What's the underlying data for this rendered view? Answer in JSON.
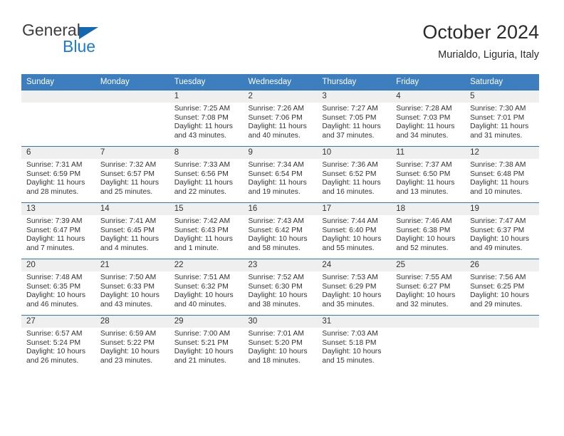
{
  "logo": {
    "word_top": "General",
    "word_bottom": "Blue",
    "triangle_color": "#1368b0",
    "blue_color": "#1b7ad1"
  },
  "header": {
    "title": "October 2024",
    "location": "Murialdo, Liguria, Italy"
  },
  "theme": {
    "header_blue": "#3c7ebe",
    "row_rule_blue": "#2f76bb",
    "daynum_band": "#efefef"
  },
  "weekday_headers": [
    "Sunday",
    "Monday",
    "Tuesday",
    "Wednesday",
    "Thursday",
    "Friday",
    "Saturday"
  ],
  "labels": {
    "sunrise": "Sunrise:",
    "sunset": "Sunset:",
    "daylight": "Daylight:"
  },
  "weeks": [
    [
      {
        "day": "",
        "sunrise": "",
        "sunset": "",
        "daylight_line1": "",
        "daylight_line2": ""
      },
      {
        "day": "",
        "sunrise": "",
        "sunset": "",
        "daylight_line1": "",
        "daylight_line2": ""
      },
      {
        "day": "1",
        "sunrise": "Sunrise: 7:25 AM",
        "sunset": "Sunset: 7:08 PM",
        "daylight_line1": "Daylight: 11 hours",
        "daylight_line2": "and 43 minutes."
      },
      {
        "day": "2",
        "sunrise": "Sunrise: 7:26 AM",
        "sunset": "Sunset: 7:06 PM",
        "daylight_line1": "Daylight: 11 hours",
        "daylight_line2": "and 40 minutes."
      },
      {
        "day": "3",
        "sunrise": "Sunrise: 7:27 AM",
        "sunset": "Sunset: 7:05 PM",
        "daylight_line1": "Daylight: 11 hours",
        "daylight_line2": "and 37 minutes."
      },
      {
        "day": "4",
        "sunrise": "Sunrise: 7:28 AM",
        "sunset": "Sunset: 7:03 PM",
        "daylight_line1": "Daylight: 11 hours",
        "daylight_line2": "and 34 minutes."
      },
      {
        "day": "5",
        "sunrise": "Sunrise: 7:30 AM",
        "sunset": "Sunset: 7:01 PM",
        "daylight_line1": "Daylight: 11 hours",
        "daylight_line2": "and 31 minutes."
      }
    ],
    [
      {
        "day": "6",
        "sunrise": "Sunrise: 7:31 AM",
        "sunset": "Sunset: 6:59 PM",
        "daylight_line1": "Daylight: 11 hours",
        "daylight_line2": "and 28 minutes."
      },
      {
        "day": "7",
        "sunrise": "Sunrise: 7:32 AM",
        "sunset": "Sunset: 6:57 PM",
        "daylight_line1": "Daylight: 11 hours",
        "daylight_line2": "and 25 minutes."
      },
      {
        "day": "8",
        "sunrise": "Sunrise: 7:33 AM",
        "sunset": "Sunset: 6:56 PM",
        "daylight_line1": "Daylight: 11 hours",
        "daylight_line2": "and 22 minutes."
      },
      {
        "day": "9",
        "sunrise": "Sunrise: 7:34 AM",
        "sunset": "Sunset: 6:54 PM",
        "daylight_line1": "Daylight: 11 hours",
        "daylight_line2": "and 19 minutes."
      },
      {
        "day": "10",
        "sunrise": "Sunrise: 7:36 AM",
        "sunset": "Sunset: 6:52 PM",
        "daylight_line1": "Daylight: 11 hours",
        "daylight_line2": "and 16 minutes."
      },
      {
        "day": "11",
        "sunrise": "Sunrise: 7:37 AM",
        "sunset": "Sunset: 6:50 PM",
        "daylight_line1": "Daylight: 11 hours",
        "daylight_line2": "and 13 minutes."
      },
      {
        "day": "12",
        "sunrise": "Sunrise: 7:38 AM",
        "sunset": "Sunset: 6:48 PM",
        "daylight_line1": "Daylight: 11 hours",
        "daylight_line2": "and 10 minutes."
      }
    ],
    [
      {
        "day": "13",
        "sunrise": "Sunrise: 7:39 AM",
        "sunset": "Sunset: 6:47 PM",
        "daylight_line1": "Daylight: 11 hours",
        "daylight_line2": "and 7 minutes."
      },
      {
        "day": "14",
        "sunrise": "Sunrise: 7:41 AM",
        "sunset": "Sunset: 6:45 PM",
        "daylight_line1": "Daylight: 11 hours",
        "daylight_line2": "and 4 minutes."
      },
      {
        "day": "15",
        "sunrise": "Sunrise: 7:42 AM",
        "sunset": "Sunset: 6:43 PM",
        "daylight_line1": "Daylight: 11 hours",
        "daylight_line2": "and 1 minute."
      },
      {
        "day": "16",
        "sunrise": "Sunrise: 7:43 AM",
        "sunset": "Sunset: 6:42 PM",
        "daylight_line1": "Daylight: 10 hours",
        "daylight_line2": "and 58 minutes."
      },
      {
        "day": "17",
        "sunrise": "Sunrise: 7:44 AM",
        "sunset": "Sunset: 6:40 PM",
        "daylight_line1": "Daylight: 10 hours",
        "daylight_line2": "and 55 minutes."
      },
      {
        "day": "18",
        "sunrise": "Sunrise: 7:46 AM",
        "sunset": "Sunset: 6:38 PM",
        "daylight_line1": "Daylight: 10 hours",
        "daylight_line2": "and 52 minutes."
      },
      {
        "day": "19",
        "sunrise": "Sunrise: 7:47 AM",
        "sunset": "Sunset: 6:37 PM",
        "daylight_line1": "Daylight: 10 hours",
        "daylight_line2": "and 49 minutes."
      }
    ],
    [
      {
        "day": "20",
        "sunrise": "Sunrise: 7:48 AM",
        "sunset": "Sunset: 6:35 PM",
        "daylight_line1": "Daylight: 10 hours",
        "daylight_line2": "and 46 minutes."
      },
      {
        "day": "21",
        "sunrise": "Sunrise: 7:50 AM",
        "sunset": "Sunset: 6:33 PM",
        "daylight_line1": "Daylight: 10 hours",
        "daylight_line2": "and 43 minutes."
      },
      {
        "day": "22",
        "sunrise": "Sunrise: 7:51 AM",
        "sunset": "Sunset: 6:32 PM",
        "daylight_line1": "Daylight: 10 hours",
        "daylight_line2": "and 40 minutes."
      },
      {
        "day": "23",
        "sunrise": "Sunrise: 7:52 AM",
        "sunset": "Sunset: 6:30 PM",
        "daylight_line1": "Daylight: 10 hours",
        "daylight_line2": "and 38 minutes."
      },
      {
        "day": "24",
        "sunrise": "Sunrise: 7:53 AM",
        "sunset": "Sunset: 6:29 PM",
        "daylight_line1": "Daylight: 10 hours",
        "daylight_line2": "and 35 minutes."
      },
      {
        "day": "25",
        "sunrise": "Sunrise: 7:55 AM",
        "sunset": "Sunset: 6:27 PM",
        "daylight_line1": "Daylight: 10 hours",
        "daylight_line2": "and 32 minutes."
      },
      {
        "day": "26",
        "sunrise": "Sunrise: 7:56 AM",
        "sunset": "Sunset: 6:25 PM",
        "daylight_line1": "Daylight: 10 hours",
        "daylight_line2": "and 29 minutes."
      }
    ],
    [
      {
        "day": "27",
        "sunrise": "Sunrise: 6:57 AM",
        "sunset": "Sunset: 5:24 PM",
        "daylight_line1": "Daylight: 10 hours",
        "daylight_line2": "and 26 minutes."
      },
      {
        "day": "28",
        "sunrise": "Sunrise: 6:59 AM",
        "sunset": "Sunset: 5:22 PM",
        "daylight_line1": "Daylight: 10 hours",
        "daylight_line2": "and 23 minutes."
      },
      {
        "day": "29",
        "sunrise": "Sunrise: 7:00 AM",
        "sunset": "Sunset: 5:21 PM",
        "daylight_line1": "Daylight: 10 hours",
        "daylight_line2": "and 21 minutes."
      },
      {
        "day": "30",
        "sunrise": "Sunrise: 7:01 AM",
        "sunset": "Sunset: 5:20 PM",
        "daylight_line1": "Daylight: 10 hours",
        "daylight_line2": "and 18 minutes."
      },
      {
        "day": "31",
        "sunrise": "Sunrise: 7:03 AM",
        "sunset": "Sunset: 5:18 PM",
        "daylight_line1": "Daylight: 10 hours",
        "daylight_line2": "and 15 minutes."
      },
      {
        "day": "",
        "sunrise": "",
        "sunset": "",
        "daylight_line1": "",
        "daylight_line2": ""
      },
      {
        "day": "",
        "sunrise": "",
        "sunset": "",
        "daylight_line1": "",
        "daylight_line2": ""
      }
    ]
  ]
}
